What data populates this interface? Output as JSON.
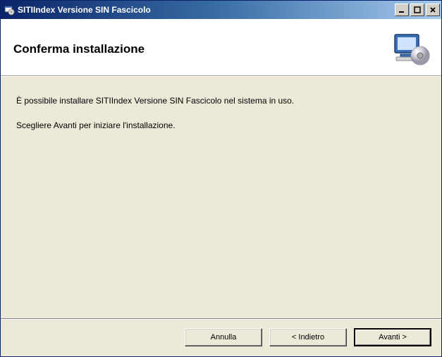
{
  "titlebar": {
    "title": "SITIIndex Versione SIN Fascicolo"
  },
  "header": {
    "title": "Conferma installazione"
  },
  "content": {
    "line1": "È possibile installare SITIIndex Versione SIN Fascicolo nel sistema in uso.",
    "line2": "Scegliere Avanti per iniziare l'installazione."
  },
  "buttons": {
    "cancel": "Annulla",
    "back": "< Indietro",
    "next": "Avanti >"
  }
}
